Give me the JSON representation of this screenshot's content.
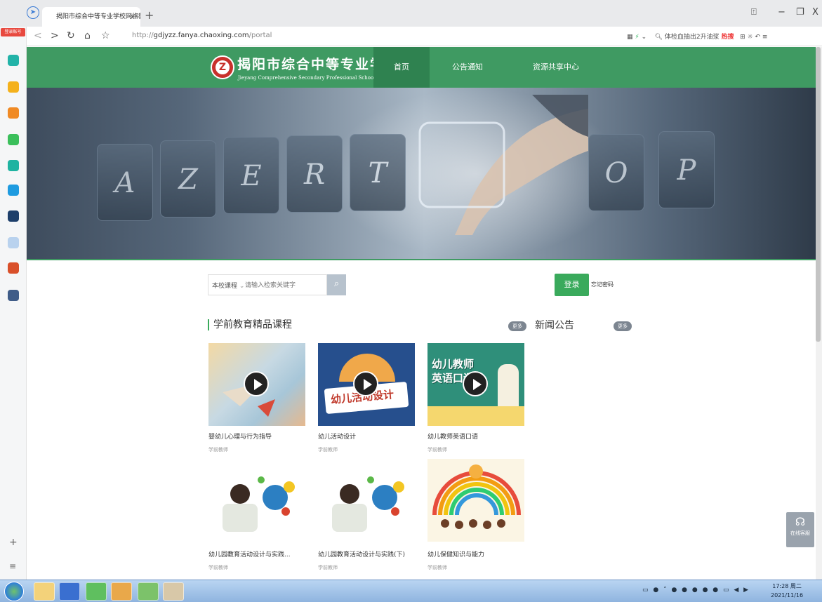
{
  "browser": {
    "tab_title": "揭阳市综合中等专业学校网络教...",
    "tab_close": "x",
    "new_tab": "+",
    "url_prefix": "http://",
    "url_host": "gdjyzz.fanya.chaoxing.com",
    "url_path": "/portal",
    "search_hint": "体检血抽出2升油浆",
    "hot_label": "热搜",
    "sidebar_tag": "登录账号",
    "window_controls": [
      "⍐",
      "−",
      "❐",
      "X"
    ]
  },
  "site": {
    "school_name": "揭阳市综合中等专业学校",
    "school_name_en": "Jieyang Comprehensive Secondary Professional School",
    "logo_letter": "Z",
    "nav": [
      {
        "label": "首页"
      },
      {
        "label": "公告通知"
      },
      {
        "label": "资源共享中心"
      }
    ]
  },
  "hero": {
    "keys": [
      "A",
      "Z",
      "E",
      "R",
      "T",
      "O",
      "P"
    ]
  },
  "search": {
    "scope": "本校课程",
    "placeholder": "请输入检索关键字",
    "button_icon": "search-icon"
  },
  "auth": {
    "login_label": "登录",
    "forgot_label": "忘记密码"
  },
  "sections": {
    "courses_title": "学前教育精品课程",
    "courses_more": "更多",
    "news_title": "新闻公告",
    "news_more": "更多"
  },
  "courses": [
    {
      "title": "婴幼儿心理与行为指导",
      "teacher": "学前教师"
    },
    {
      "title": "幼儿活动设计",
      "teacher": "学前教师"
    },
    {
      "title": "幼儿教师英语口语",
      "teacher": "学前教师"
    },
    {
      "title": "幼儿园教育活动设计与实践...",
      "teacher": "学前教师"
    },
    {
      "title": "幼儿园教育活动设计与实践(下)",
      "teacher": "学前教师"
    },
    {
      "title": "幼儿保健知识与能力",
      "teacher": "学前教师"
    }
  ],
  "thumb_text": {
    "c2": "幼儿活动设计",
    "c3": "幼儿教师英语口语"
  },
  "service": {
    "label": "在线客服"
  },
  "taskbar": {
    "time": "17:28 周二",
    "date": "2021/11/16"
  },
  "colors": {
    "header_green": "#3f9a62",
    "login_green": "#3aaa5c"
  }
}
